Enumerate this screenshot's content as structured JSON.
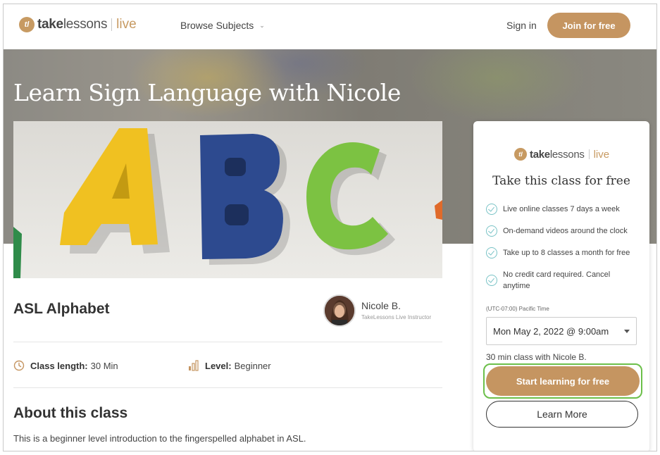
{
  "header": {
    "logo": {
      "take": "take",
      "lessons": "lessons",
      "live": "live"
    },
    "browse_label": "Browse Subjects",
    "signin_label": "Sign in",
    "join_label": "Join for free"
  },
  "hero": {
    "title": "Learn Sign Language with Nicole"
  },
  "class": {
    "title": "ASL Alphabet",
    "instructor_name": "Nicole B.",
    "instructor_role": "TakeLessons Live Instructor",
    "length_label": "Class length:",
    "length_value": "30 Min",
    "level_label": "Level:",
    "level_value": "Beginner",
    "about_title": "About this class",
    "about_text": "This is a beginner level introduction to the fingerspelled alphabet in ASL."
  },
  "card": {
    "title": "Take this class for free",
    "features": [
      "Live online classes 7 days a week",
      "On-demand videos around the clock",
      "Take up to 8 classes a month for free",
      "No credit card required. Cancel anytime"
    ],
    "timezone": "(UTC-07:00) Pacific Time",
    "selected_time": "Mon May 2, 2022 @ 9:00am",
    "duration_text": "30 min class with Nicole B.",
    "start_label": "Start learning for free",
    "learn_label": "Learn More"
  },
  "colors": {
    "brand": "#c59561",
    "check": "#79c3c6",
    "highlight": "#6cbf4a"
  }
}
